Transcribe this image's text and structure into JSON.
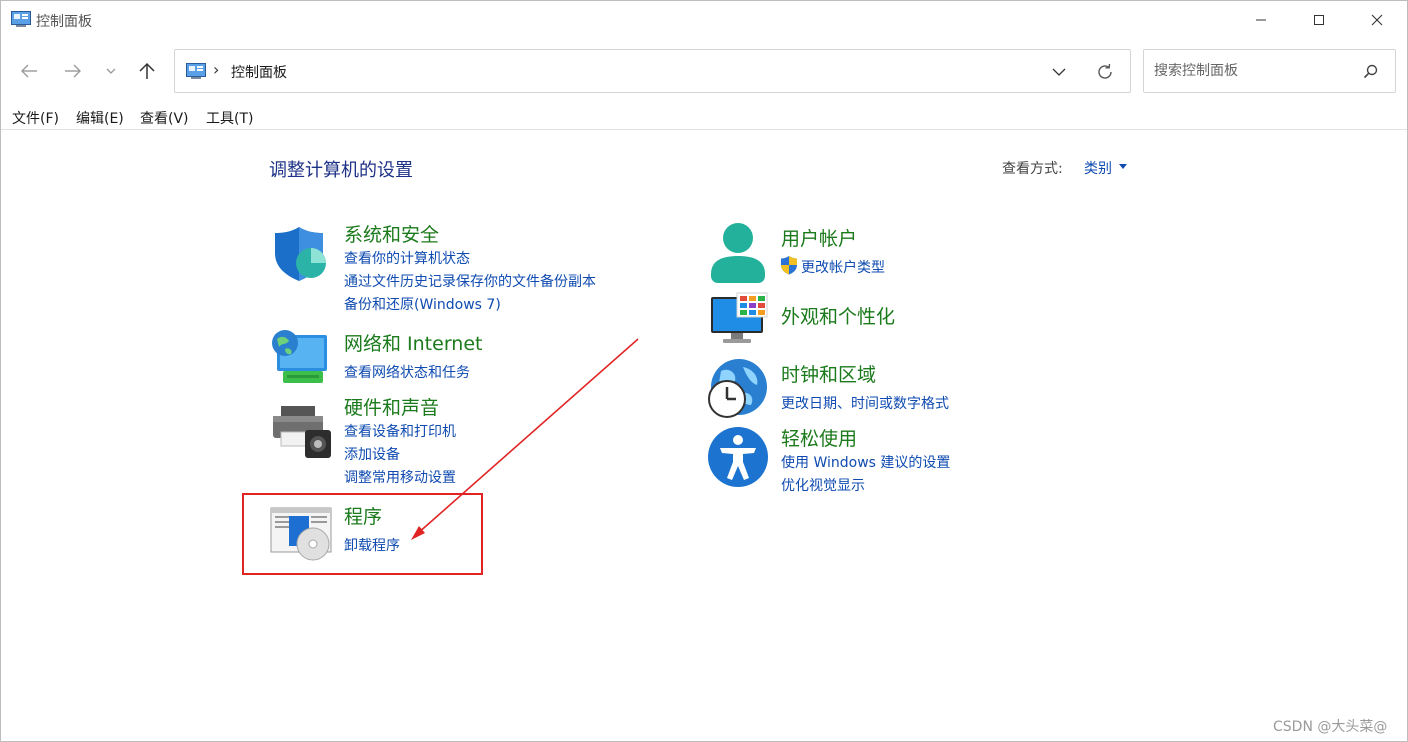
{
  "window": {
    "title": "控制面板"
  },
  "nav": {
    "address_path": "控制面板",
    "address_separator": "›",
    "search_placeholder": "搜索控制面板"
  },
  "menu": {
    "items": [
      "文件(F)",
      "编辑(E)",
      "查看(V)",
      "工具(T)"
    ]
  },
  "content": {
    "page_title": "调整计算机的设置",
    "view_by_label": "查看方式:",
    "view_by_value": "类别"
  },
  "categories": {
    "system_security": {
      "title": "系统和安全",
      "links": [
        "查看你的计算机状态",
        "通过文件历史记录保存你的文件备份副本",
        "备份和还原(Windows 7)"
      ]
    },
    "network": {
      "title": "网络和 Internet",
      "links": [
        "查看网络状态和任务"
      ]
    },
    "hardware": {
      "title": "硬件和声音",
      "links": [
        "查看设备和打印机",
        "添加设备",
        "调整常用移动设置"
      ]
    },
    "programs": {
      "title": "程序",
      "links": [
        "卸载程序"
      ]
    },
    "user_accounts": {
      "title": "用户帐户",
      "links": [
        "更改帐户类型"
      ]
    },
    "appearance": {
      "title": "外观和个性化",
      "links": []
    },
    "clock_region": {
      "title": "时钟和区域",
      "links": [
        "更改日期、时间或数字格式"
      ]
    },
    "ease_of_access": {
      "title": "轻松使用",
      "links": [
        "使用 Windows 建议的设置",
        "优化视觉显示"
      ]
    }
  },
  "watermark": "CSDN @大头菜@",
  "colors": {
    "category_title": "#1b7a1b",
    "link": "#0f4bb0",
    "page_title": "#1e3287",
    "annotation_red": "#e02424"
  }
}
